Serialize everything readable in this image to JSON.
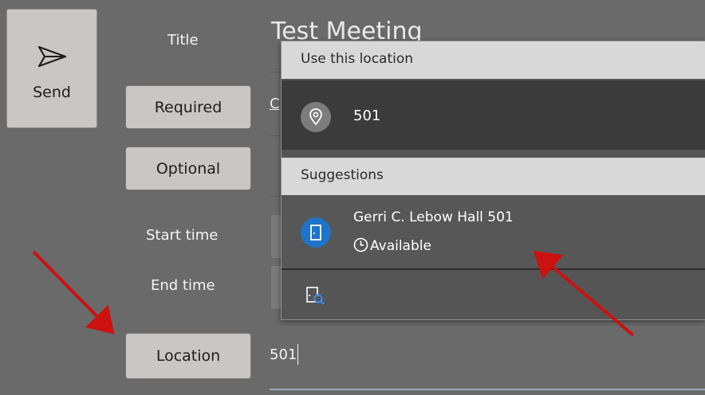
{
  "toolbar": {
    "send_label": "Send"
  },
  "form": {
    "title_label": "Title",
    "title_value": "Test Meeting",
    "required_label": "Required",
    "optional_label": "Optional",
    "start_time_label": "Start time",
    "end_time_label": "End time",
    "location_label": "Location",
    "location_value": "501",
    "required_partial": "C"
  },
  "dropdown": {
    "use_header": "Use this location",
    "use_value": "501",
    "suggestions_header": "Suggestions",
    "suggestion": {
      "name": "Gerri C. Lebow Hall 501",
      "status": "Available"
    }
  },
  "colors": {
    "accent_blue": "#1e74c8",
    "annotation_red": "#cc1111"
  }
}
